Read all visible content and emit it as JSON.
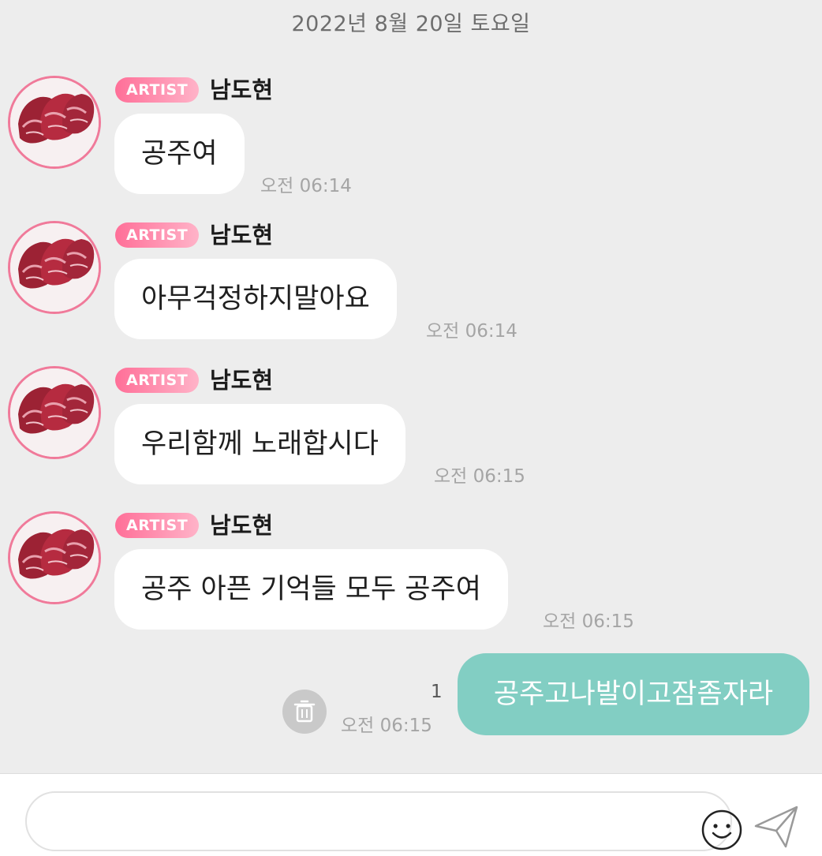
{
  "date_header": "2022년 8월 20일 토요일",
  "artist_badge": "ARTIST",
  "messages": [
    {
      "sender": "남도현",
      "text": "공주여",
      "time": "오전 06:14"
    },
    {
      "sender": "남도현",
      "text": "아무걱정하지말아요",
      "time": "오전 06:14"
    },
    {
      "sender": "남도현",
      "text": "우리함께 노래합시다",
      "time": "오전 06:15"
    },
    {
      "sender": "남도현",
      "text": "공주 아픈 기억들 모두 공주여",
      "time": "오전 06:15"
    }
  ],
  "my_message": {
    "text": "공주고나발이고잠좀자라",
    "time": "오전 06:15",
    "unread_count": "1"
  },
  "input": {
    "value": "",
    "placeholder": ""
  },
  "icons": {
    "avatar": "steak-meat-avatar",
    "delete": "trash-icon",
    "emoji": "smiley-icon",
    "send": "paper-plane-icon"
  },
  "colors": {
    "background": "#ededed",
    "incoming_bubble": "#ffffff",
    "outgoing_bubble": "#82cec3",
    "badge_start": "#ff6f98",
    "badge_end": "#ffb3c8",
    "avatar_ring": "#f07a9a"
  }
}
